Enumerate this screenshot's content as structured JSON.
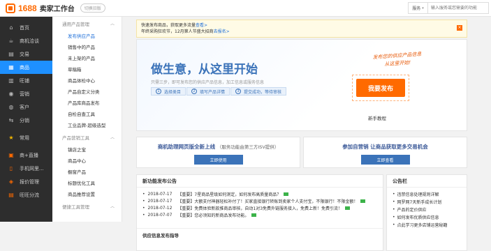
{
  "header": {
    "logo": "1688",
    "app_name": "卖家工作台",
    "switch_old": "切换旧版",
    "search_category": "服务",
    "search_placeholder": "输入服务或您需要的功能"
  },
  "leftnav": {
    "items": [
      {
        "label": "首页",
        "icon": "home-icon"
      },
      {
        "label": "商机洽谈",
        "icon": "chat-icon"
      },
      {
        "label": "交易",
        "icon": "trade-icon"
      },
      {
        "label": "商品",
        "icon": "product-icon",
        "active": true
      },
      {
        "label": "旺铺",
        "icon": "shop-icon"
      },
      {
        "label": "营销",
        "icon": "marketing-icon"
      },
      {
        "label": "客户",
        "icon": "customer-icon"
      },
      {
        "label": "分销",
        "icon": "distribution-icon"
      },
      {
        "label": "常用",
        "icon": "star-icon"
      },
      {
        "label": "商+直播",
        "icon": "live-icon"
      },
      {
        "label": "手机网里...",
        "icon": "mobile-icon"
      },
      {
        "label": "报价管理",
        "icon": "quote-icon"
      },
      {
        "label": "旺旺分流",
        "icon": "wangwang-icon"
      }
    ]
  },
  "subnav": {
    "group1": "通用产品管理",
    "group1_items": [
      "发布供应产品",
      "销售中的产品",
      "未上架的产品",
      "草稿箱",
      "商品体检中心",
      "产品自定义分类",
      "产品库商品发布",
      "自检自查工具",
      "工业品牌-超级选型"
    ],
    "group2": "产品营销工具",
    "group2_items": [
      "镇店之宝",
      "商品中心",
      "橱窗产品",
      "标题优化工具",
      "商品推荐设置"
    ],
    "group3": "便捷工具管理"
  },
  "notice": {
    "line1": "快速发布商品，获取更多流量",
    "line1_link": "查看>",
    "line2": "年终采购狂欢节，12月第人节盛大招商",
    "line2_link": "去报名>"
  },
  "hero": {
    "title": "做生意，从这里开始",
    "desc": "只需三步，即可发布您的供应产品信息，加工信息或服务信息",
    "steps": [
      {
        "num": "1",
        "label": "选择类目"
      },
      {
        "num": "2",
        "label": "填写产品详情"
      },
      {
        "num": "3",
        "label": "提交成功，等待审核"
      }
    ],
    "slogan_line1": "发布您的供应产品信息",
    "slogan_line2": "从这里开始!",
    "publish_button": "我要发布",
    "guide_link": "新手教程"
  },
  "promos": [
    {
      "title": "商机助理网页版全新上线",
      "sub": "（服务功能由第三方ISV提供）",
      "button": "立即使用"
    },
    {
      "title": "参加自营销 让商品获取更多交易机会",
      "sub": "",
      "button": "立即查看"
    }
  ],
  "announcements": {
    "title": "新功能发布公告",
    "items": [
      {
        "date": "2018-07-17",
        "text": "【重要】7星商品星级如何测定，如何发布高质量商品？"
      },
      {
        "date": "2018-07-17",
        "text": "【重要】大额支付神器轻松补付了！买家直接银行转账到卖家个人支付宝，不限银行！不限金额！"
      },
      {
        "date": "2018-07-12",
        "text": "【重要】免费体验新款推商品审核，自动1对3免费外链服务接入，免费上新！免费引流！"
      },
      {
        "date": "2018-07-07",
        "text": "【重要】您必须知的新商品发布功能。"
      }
    ],
    "sub_title": "供应信息发布指导"
  },
  "board": {
    "title": "公告栏",
    "items": [
      "违禁信息处理规则详解",
      "网罗网7天新手成长计划",
      "产品的定价供应",
      "如何发布优质供应信息",
      "点此学习更多店铺运营秘籍"
    ]
  },
  "colors": {
    "accent": "#ff6a00",
    "nav_active": "#1e90ff",
    "primary": "#3b73b9"
  }
}
